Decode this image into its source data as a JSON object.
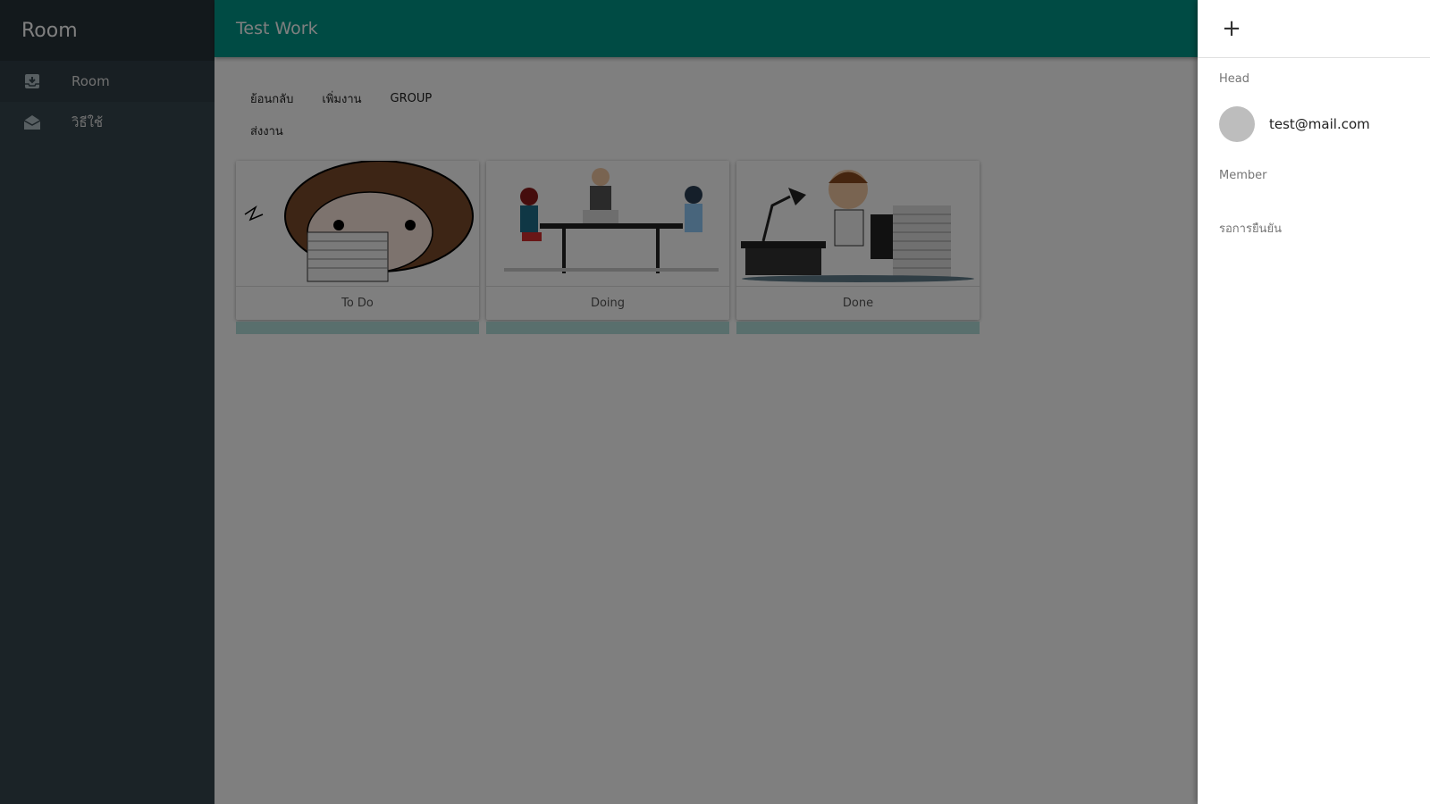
{
  "sidebar": {
    "title": "Room",
    "items": [
      {
        "label": "Room",
        "icon": "inbox-icon"
      },
      {
        "label": "วิธีใช้",
        "icon": "mail-open-icon"
      }
    ]
  },
  "appbar": {
    "title": "Test Work"
  },
  "toolbar": {
    "back_label": "ย้อนกลับ",
    "add_task_label": "เพิ่มงาน",
    "group_label": "GROUP",
    "submit_label": "ส่งงาน"
  },
  "boards": [
    {
      "label": "To Do"
    },
    {
      "label": "Doing"
    },
    {
      "label": "Done"
    }
  ],
  "drawer": {
    "add_icon": "+",
    "head_label": "Head",
    "head_email": "test@mail.com",
    "member_label": "Member",
    "pending_label": "รอการยืนยัน"
  },
  "colors": {
    "appbar": "#009688",
    "sidebar": "#37474f",
    "sidebar_header": "#263238",
    "board_strip": "#b2dfdb"
  }
}
